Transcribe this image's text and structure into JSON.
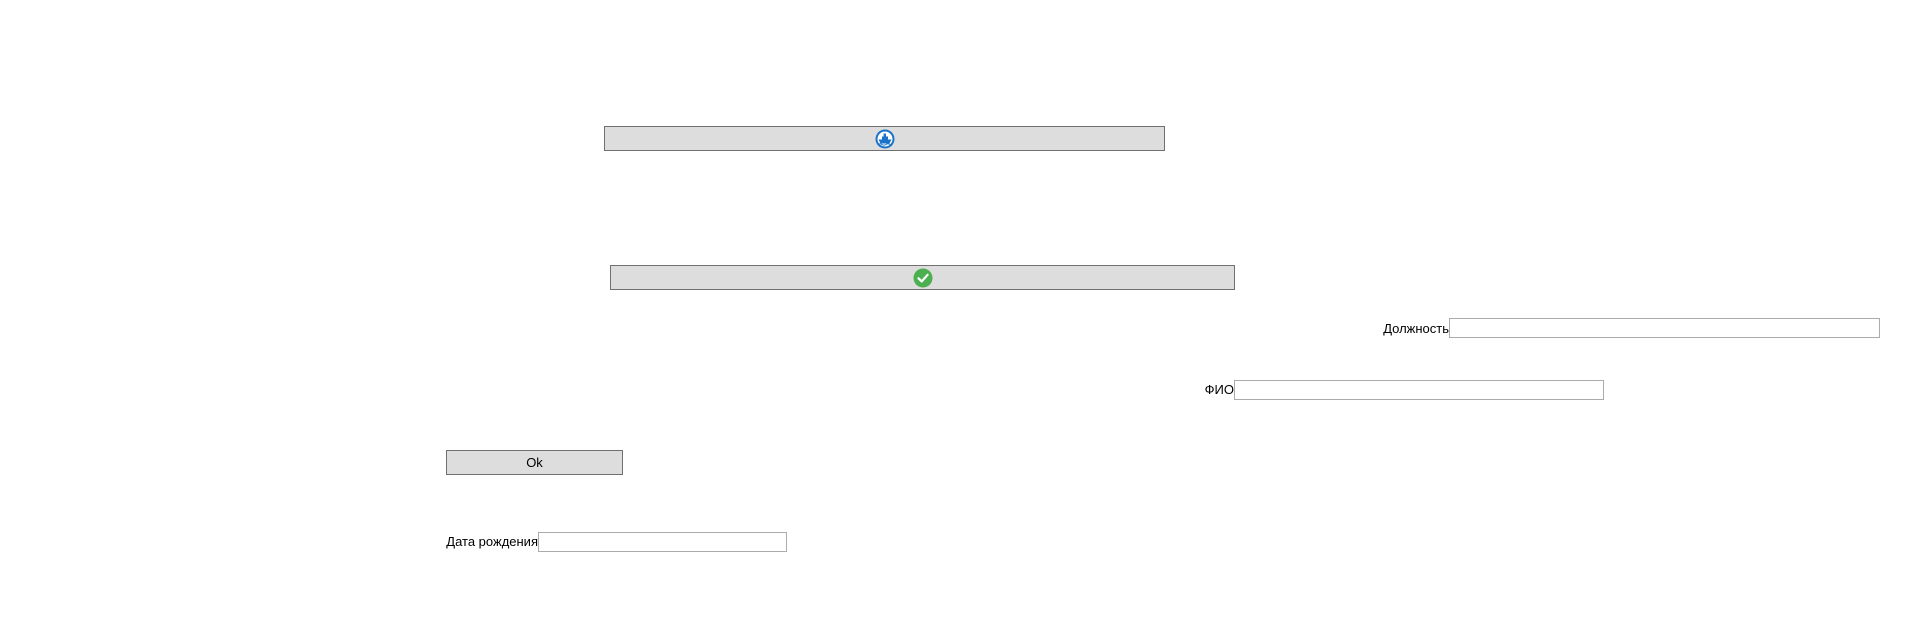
{
  "buttons": {
    "ship_button": {
      "icon": "ship-icon",
      "icon_color": "#1a73c8"
    },
    "check_button": {
      "icon": "check-circle-icon",
      "icon_color": "#4caf50"
    },
    "ok_button": {
      "label": "Ok"
    }
  },
  "fields": {
    "position": {
      "label": "Должность",
      "value": ""
    },
    "fio": {
      "label": "ФИО",
      "value": ""
    },
    "birth_date": {
      "label": "Дата рождения",
      "value": ""
    }
  },
  "colors": {
    "button_bg": "#dddddd",
    "button_border": "#707070",
    "input_border": "#ababab"
  }
}
